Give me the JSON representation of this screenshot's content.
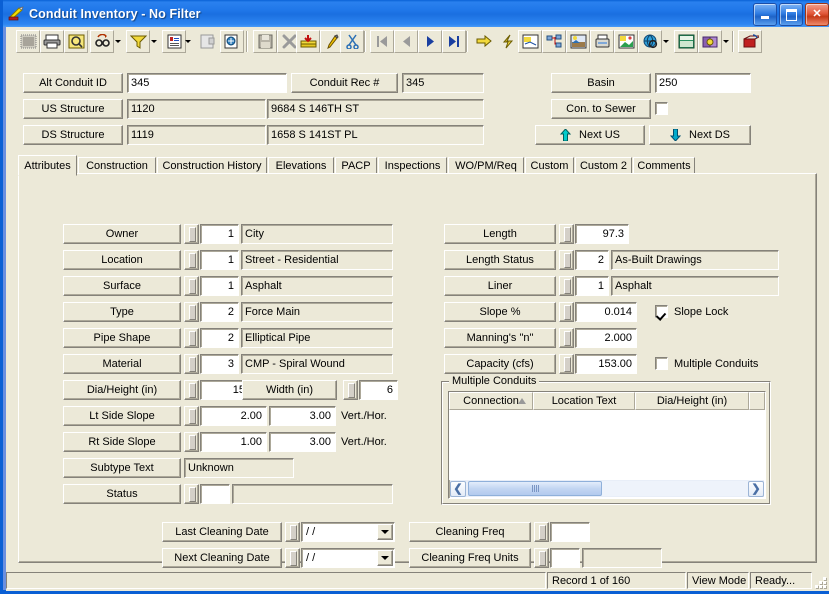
{
  "window": {
    "title": "Conduit Inventory - No Filter",
    "icon": "conduit-app-icon",
    "minimize": "–",
    "maximize": "□",
    "close": "✕"
  },
  "toolbar": {
    "buttons": [
      {
        "name": "grid-view-icon",
        "label": ""
      },
      {
        "name": "print-icon",
        "label": ""
      },
      {
        "name": "print-preview-icon",
        "label": ""
      },
      {
        "name": "find-icon",
        "label": ""
      },
      {
        "name": "filter-icon",
        "label": ""
      },
      {
        "name": "report-icon",
        "label": ""
      },
      {
        "name": "properties-icon",
        "label": ""
      },
      {
        "name": "copy-record-icon",
        "label": ""
      },
      {
        "name": "save-icon",
        "label": ""
      },
      {
        "name": "delete-icon",
        "label": ""
      },
      {
        "name": "add-record-icon",
        "label": ""
      },
      {
        "name": "edit-icon",
        "label": ""
      },
      {
        "name": "cut-icon",
        "label": ""
      },
      {
        "name": "first-record-icon",
        "label": ""
      },
      {
        "name": "previous-record-icon",
        "label": ""
      },
      {
        "name": "next-record-icon",
        "label": ""
      },
      {
        "name": "last-record-icon",
        "label": ""
      },
      {
        "name": "goto-icon",
        "label": ""
      },
      {
        "name": "lightning-icon",
        "label": ""
      },
      {
        "name": "map-icon",
        "label": ""
      },
      {
        "name": "hierarchy-icon",
        "label": ""
      },
      {
        "name": "image-icon",
        "label": ""
      },
      {
        "name": "fax-icon",
        "label": ""
      },
      {
        "name": "photo-icon",
        "label": ""
      },
      {
        "name": "globe-search-icon",
        "label": ""
      },
      {
        "name": "calculator-icon",
        "label": ""
      },
      {
        "name": "book-icon",
        "label": ""
      },
      {
        "name": "exit-icon",
        "label": ""
      }
    ]
  },
  "header": {
    "alt_conduit_id": {
      "label": "Alt Conduit ID",
      "value": "345"
    },
    "conduit_rec": {
      "label": "Conduit Rec #",
      "value": "345"
    },
    "us_structure": {
      "label": "US Structure",
      "value": "1120",
      "address": "9684  S  146TH ST"
    },
    "ds_structure": {
      "label": "DS Structure",
      "value": "1119",
      "address": "1658  S  141ST PL"
    },
    "basin": {
      "label": "Basin",
      "value": "250"
    },
    "con_to_sewer": {
      "label": "Con. to Sewer",
      "checked": false
    },
    "next_us": {
      "label": "Next US",
      "arrow": "up-arrow-icon"
    },
    "next_ds": {
      "label": "Next DS",
      "arrow": "down-arrow-icon"
    }
  },
  "tabs": {
    "selected": "Attributes",
    "items": [
      {
        "label": "Attributes"
      },
      {
        "label": "Construction"
      },
      {
        "label": "Construction History"
      },
      {
        "label": "Elevations"
      },
      {
        "label": "PACP"
      },
      {
        "label": "Inspections"
      },
      {
        "label": "WO/PM/Req"
      },
      {
        "label": "Custom"
      },
      {
        "label": "Custom 2"
      },
      {
        "label": "Comments"
      }
    ]
  },
  "attributes": {
    "left": [
      {
        "label": "Owner",
        "code": "1",
        "text": "City"
      },
      {
        "label": "Location",
        "code": "1",
        "text": "Street - Residential"
      },
      {
        "label": "Surface",
        "code": "1",
        "text": "Asphalt"
      },
      {
        "label": "Type",
        "code": "2",
        "text": "Force Main"
      },
      {
        "label": "Pipe Shape",
        "code": "2",
        "text": "Elliptical Pipe"
      },
      {
        "label": "Material",
        "code": "3",
        "text": "CMP - Spiral Wound"
      }
    ],
    "dia_height": {
      "label": "Dia/Height (in)",
      "value": "15"
    },
    "width": {
      "label": "Width (in)",
      "value": "6"
    },
    "lt_side_slope": {
      "label": "Lt Side Slope",
      "vert": "2.00",
      "hor": "3.00",
      "units": "Vert./Hor."
    },
    "rt_side_slope": {
      "label": "Rt Side Slope",
      "vert": "1.00",
      "hor": "3.00",
      "units": "Vert./Hor."
    },
    "subtype_text": {
      "label": "Subtype Text",
      "value": "Unknown"
    },
    "status": {
      "label": "Status",
      "code": "",
      "text": ""
    },
    "right": [
      {
        "label": "Length",
        "value": "97.3",
        "text": null
      },
      {
        "label": "Length Status",
        "value": "2",
        "text": "As-Built Drawings"
      },
      {
        "label": "Liner",
        "value": "1",
        "text": "Asphalt"
      },
      {
        "label": "Slope %",
        "value": "0.014",
        "text": null
      },
      {
        "label": "Manning's \"n\"",
        "value": "2.000",
        "text": null
      },
      {
        "label": "Capacity (cfs)",
        "value": "153.00",
        "text": null
      }
    ],
    "slope_lock": {
      "label": "Slope Lock",
      "checked": true
    },
    "multiple_conduits_check": {
      "label": "Multiple Conduits",
      "checked": false
    }
  },
  "multiple_conduits": {
    "title": "Multiple Conduits",
    "columns": [
      "Connection",
      "Location Text",
      "Dia/Height (in)",
      ""
    ],
    "sort_column": "Connection",
    "sort_direction": "ascending",
    "rows": []
  },
  "cleaning": {
    "last_cleaning_date": {
      "label": "Last Cleaning Date",
      "value": "  /  /"
    },
    "next_cleaning_date": {
      "label": "Next Cleaning Date",
      "value": "  /  /"
    },
    "cleaning_freq": {
      "label": "Cleaning Freq",
      "value": ""
    },
    "cleaning_freq_units": {
      "label": "Cleaning Freq Units",
      "code": "",
      "text": ""
    }
  },
  "statusbar": {
    "record": "Record 1 of 160",
    "mode": "View Mode",
    "state": "Ready..."
  }
}
